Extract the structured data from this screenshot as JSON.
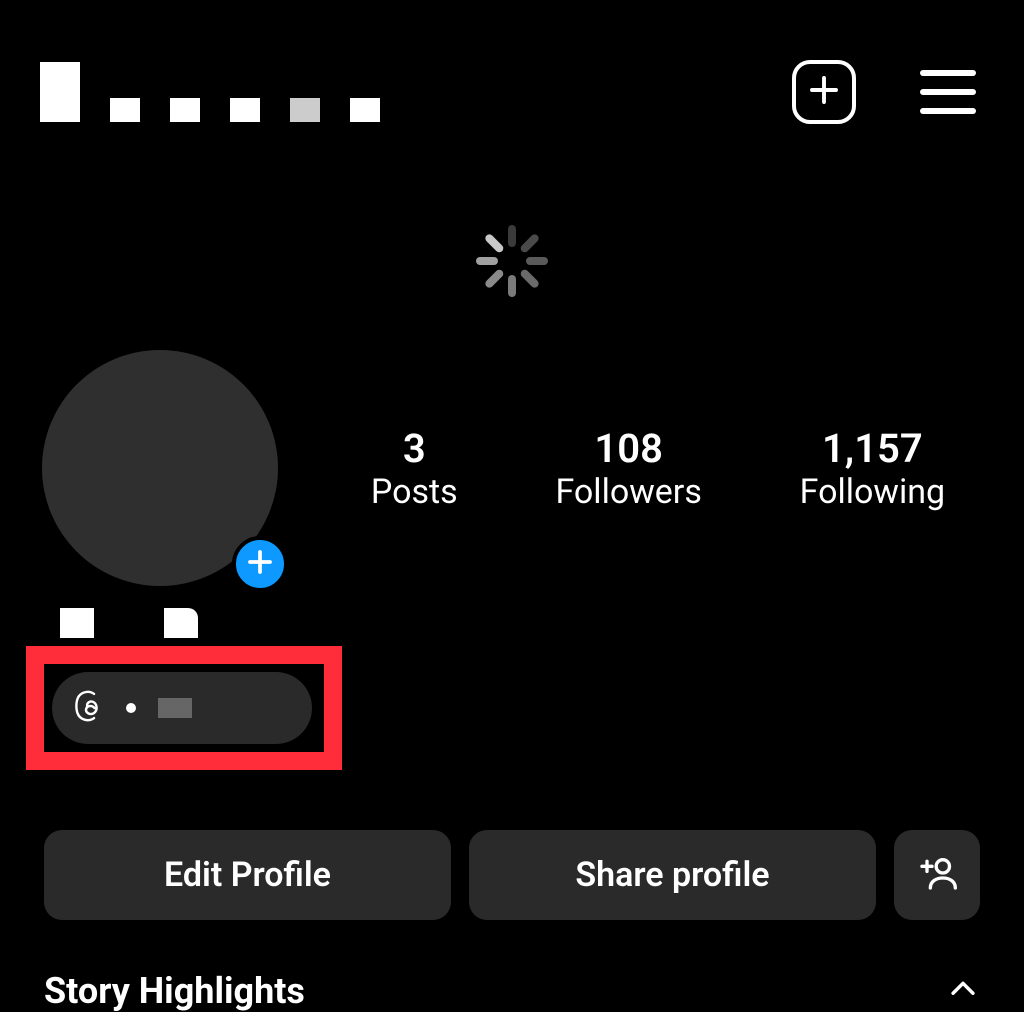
{
  "header": {
    "create_tooltip": "Create",
    "menu_tooltip": "Menu"
  },
  "stats": {
    "posts": {
      "count": "3",
      "label": "Posts"
    },
    "followers": {
      "count": "108",
      "label": "Followers"
    },
    "following": {
      "count": "1,157",
      "label": "Following"
    }
  },
  "actions": {
    "edit": "Edit Profile",
    "share": "Share profile",
    "discover_tooltip": "Discover people"
  },
  "highlights": {
    "title": "Story Highlights"
  },
  "colors": {
    "accent_blue": "#0d99ff",
    "highlight_red": "#ff2d3a",
    "panel_gray": "#2a2a2a"
  }
}
